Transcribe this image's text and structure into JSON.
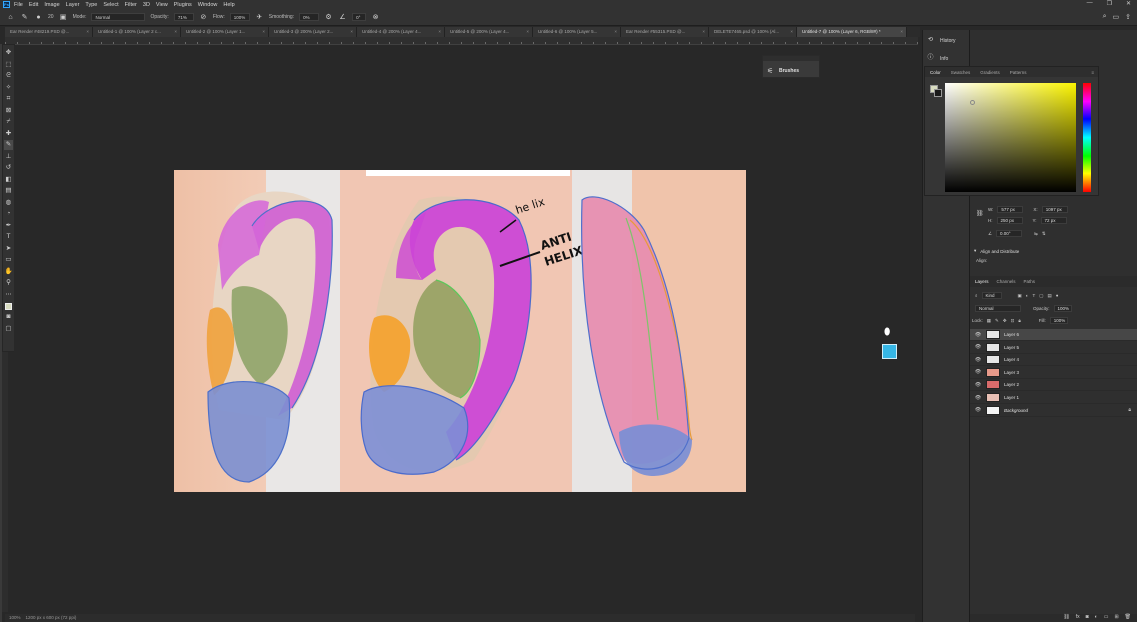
{
  "menu": [
    "File",
    "Edit",
    "Image",
    "Layer",
    "Type",
    "Select",
    "Filter",
    "3D",
    "View",
    "Plugins",
    "Window",
    "Help"
  ],
  "window_controls": [
    "—",
    "❐",
    "✕"
  ],
  "options": {
    "mode_label": "Mode:",
    "mode_value": "Normal",
    "opacity_label": "Opacity:",
    "opacity_value": "71%",
    "flow_label": "Flow:",
    "flow_value": "100%",
    "smoothing_label": "Smoothing:",
    "smoothing_value": "0%",
    "angle_value": "0°",
    "brush_size": "20"
  },
  "tabs": [
    {
      "label": "Ear Render #48219.PSD @...",
      "active": false
    },
    {
      "label": "Untitled-1 @ 100% (Layer 2 c...",
      "active": false
    },
    {
      "label": "Untitled-2 @ 100% (Layer 1...",
      "active": false
    },
    {
      "label": "Untitled-3 @ 200% (Layer 2...",
      "active": false
    },
    {
      "label": "Untitled-4 @ 200% (Layer 4...",
      "active": false
    },
    {
      "label": "Untitled-5 @ 200% (Layer 4...",
      "active": false
    },
    {
      "label": "Untitled-6 @ 100% (Layer 5...",
      "active": false
    },
    {
      "label": "Ear Render #55315.PSD @...",
      "active": false
    },
    {
      "label": "DELETE7465.psd @ 100% (Al...",
      "active": false
    },
    {
      "label": "Untitled-7 @ 100% (Layer 6, RGB/8#) *",
      "active": true
    }
  ],
  "brushes_panel": {
    "label": "Brushes"
  },
  "artwork": {
    "annotation_helix": "he lix",
    "annotation_antihelix_1": "ANTI",
    "annotation_antihelix_2": "HELIX"
  },
  "status": {
    "zoom": "100%",
    "doc_size": "1200 px x 600 px (72 ppi)"
  },
  "dock": {
    "history": "History",
    "info": "Info"
  },
  "color_panel": {
    "tabs": [
      "Color",
      "Swatches",
      "Gradients",
      "Patterns"
    ],
    "active_tab": "Color"
  },
  "properties": {
    "w_label": "W:",
    "w_value": "577 px",
    "x_label": "X:",
    "x_value": "1097 px",
    "h_label": "H:",
    "h_value": "250 px",
    "y_label": "Y:",
    "y_value": "72 px",
    "angle_value": "0.00°",
    "align_title": "Align and Distribute",
    "align_label": "Align:"
  },
  "layers_panel": {
    "tabs": [
      "Layers",
      "Channels",
      "Paths"
    ],
    "active_tab": "Layers",
    "kind_label": "Kind",
    "blend_mode": "Normal",
    "opacity_label": "Opacity:",
    "opacity_value": "100%",
    "lock_label": "Lock:",
    "fill_label": "Fill:",
    "fill_value": "100%",
    "layers": [
      {
        "name": "Layer 6",
        "selected": true,
        "locked": false
      },
      {
        "name": "Layer 5",
        "selected": false,
        "locked": false
      },
      {
        "name": "Layer 4",
        "selected": false,
        "locked": false
      },
      {
        "name": "Layer 3",
        "selected": false,
        "locked": false
      },
      {
        "name": "Layer 2",
        "selected": false,
        "locked": false
      },
      {
        "name": "Layer 1",
        "selected": false,
        "locked": false
      },
      {
        "name": "Background",
        "selected": false,
        "locked": true
      }
    ]
  },
  "colors": {
    "foreground": "#d8dcc0",
    "background": "#1a1a1a",
    "accent": "#36b7e6"
  }
}
